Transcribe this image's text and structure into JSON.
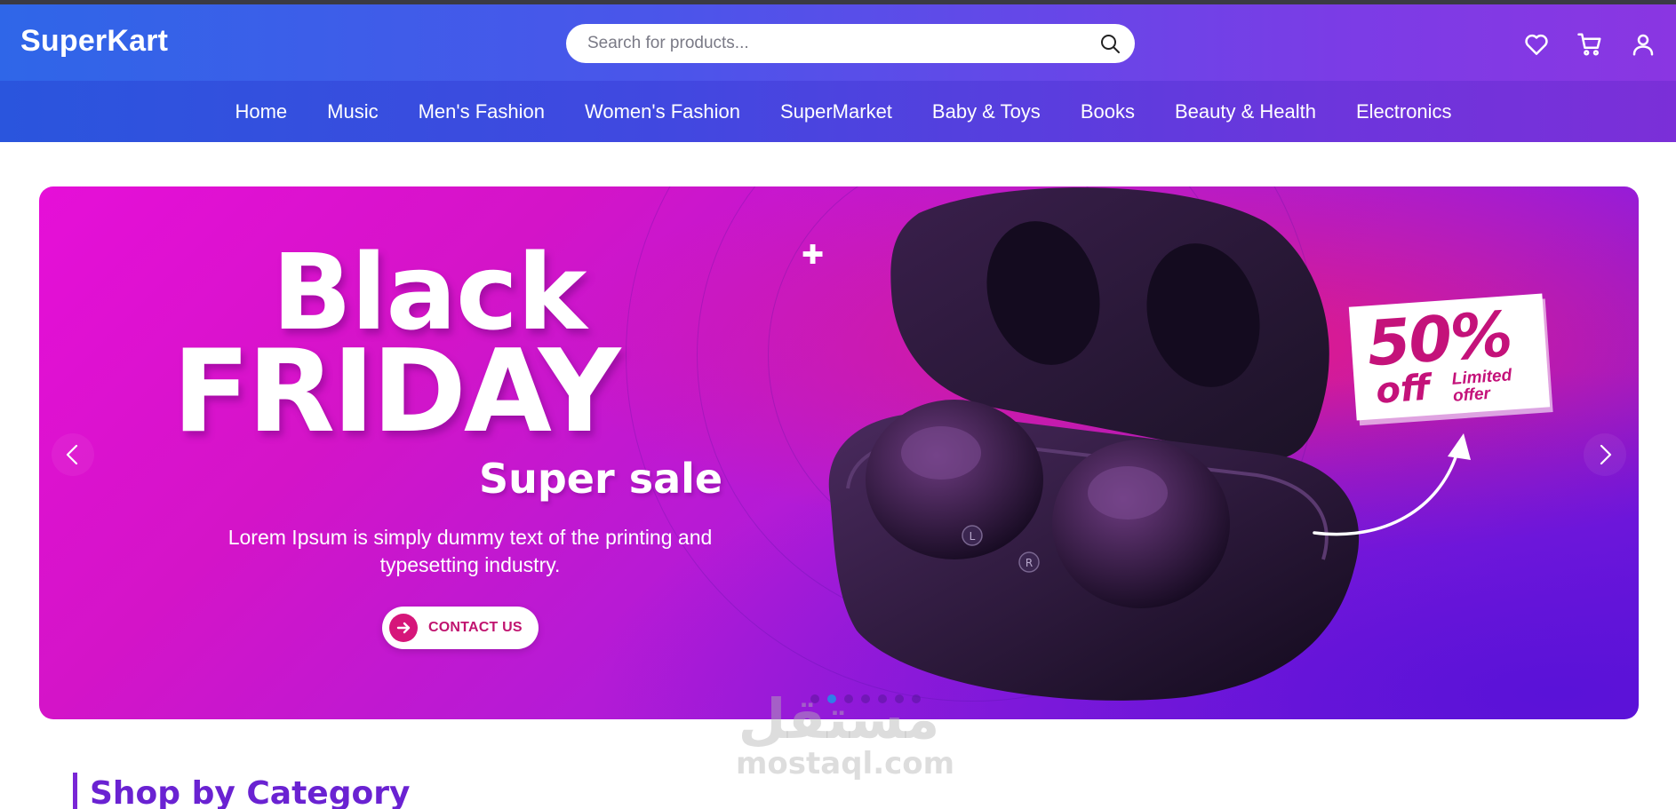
{
  "header": {
    "logo": "SuperKart",
    "search_placeholder": "Search for products...",
    "icons": [
      "search-icon",
      "heart-icon",
      "cart-icon",
      "user-icon"
    ]
  },
  "nav": {
    "items": [
      "Home",
      "Music",
      "Men's Fashion",
      "Women's Fashion",
      "SuperMarket",
      "Baby & Toys",
      "Books",
      "Beauty & Health",
      "Electronics"
    ]
  },
  "banner": {
    "headline_1": "Black",
    "headline_2": "FRIDAY",
    "subhead": "Super sale",
    "description": "Lorem Ipsum is simply dummy text of the printing and typesetting industry.",
    "cta": "CONTACT US",
    "offer_percent": "50%",
    "offer_off": "off",
    "offer_limited_1": "Limited",
    "offer_limited_2": "offer",
    "earbud_labels": [
      "L",
      "R"
    ],
    "slide_count": 7,
    "active_slide": 1
  },
  "watermark": {
    "arabic": "مستقل",
    "latin": "mostaql.com"
  },
  "section": {
    "title": "Shop by Category"
  },
  "colors": {
    "header_gradient_start": "#2f66e8",
    "header_gradient_end": "#8a36e2",
    "accent_pink": "#c4127a",
    "section_title": "#6a22d2"
  }
}
